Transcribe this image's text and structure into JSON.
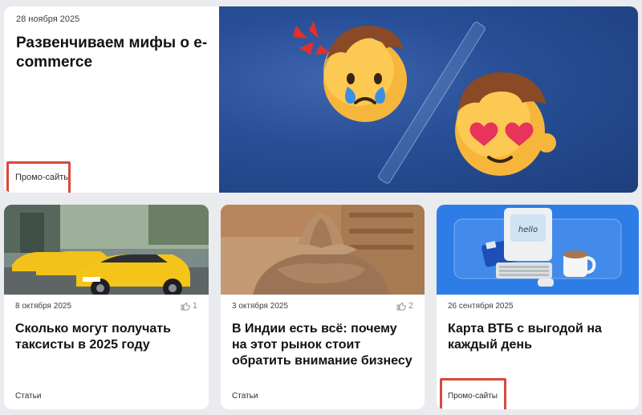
{
  "hero": {
    "date": "28 ноября 2025",
    "title": "Развенчиваем мифы о e-commerce",
    "tag": "Промо-сайты",
    "image_icon": "sad-and-in-love-emoji-illustration"
  },
  "cards": [
    {
      "date": "8 октября 2025",
      "likes": "1",
      "title": "Сколько могут получать таксисты в 2025 году",
      "tag": "Статьи",
      "image_icon": "yellow-taxi-cars-photo"
    },
    {
      "date": "3 октября 2025",
      "likes": "2",
      "title": "В Индии есть всё: почему на этот рынок стоит обратить внимание бизнесу",
      "tag": "Статьи",
      "image_icon": "stone-hands-holding-lotus-photo"
    },
    {
      "date": "26 сентября 2025",
      "title": "Карта ВТБ с выгодой на каждый день",
      "tag": "Промо-сайты",
      "image_icon": "retro-computer-and-card-illustration",
      "screen_text": "hello"
    }
  ],
  "colors": {
    "background": "#e9ebef",
    "highlight_outline": "#d64a3b",
    "hero_blue": "#284f97",
    "vtb_blue": "#2e7de6",
    "taxi_yellow": "#f2c21b"
  }
}
